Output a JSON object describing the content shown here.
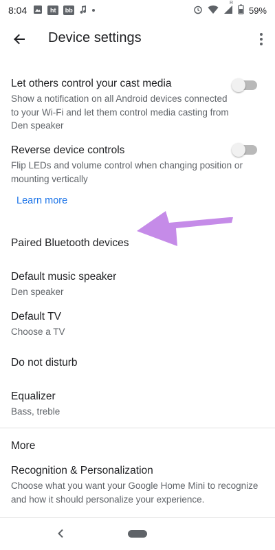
{
  "status_bar": {
    "time": "8:04",
    "battery": "59%",
    "notification_badges": [
      "ht",
      "bb"
    ],
    "signal_label": "R"
  },
  "app_bar": {
    "title": "Device settings"
  },
  "settings": {
    "cast_media": {
      "title": "Let others control your cast media",
      "subtitle": "Show a notification on all Android devices connected to your Wi-Fi and let them control media casting from Den speaker",
      "enabled": false
    },
    "reverse_controls": {
      "title": "Reverse device controls",
      "subtitle": "Flip LEDs and volume control when changing position or mounting vertically",
      "enabled": false
    },
    "learn_more": "Learn more",
    "paired_bluetooth": {
      "title": "Paired Bluetooth devices"
    },
    "default_music_speaker": {
      "title": "Default music speaker",
      "subtitle": "Den speaker"
    },
    "default_tv": {
      "title": "Default TV",
      "subtitle": "Choose a TV"
    },
    "do_not_disturb": {
      "title": "Do not disturb"
    },
    "equalizer": {
      "title": "Equalizer",
      "subtitle": "Bass, treble"
    }
  },
  "more_section": {
    "header": "More",
    "recognition": {
      "title": "Recognition & Personalization",
      "subtitle": "Choose what you want your Google Home Mini to recognize and how it should personalize your experience."
    }
  },
  "colors": {
    "link": "#1a73e8",
    "annotation_arrow": "#c58be8",
    "toggle_track_off": "#b9b9b9"
  },
  "icons": {
    "back": "arrow-left-icon",
    "overflow": "more-vert-icon",
    "nav_back": "chevron-left-icon",
    "nav_home": "home-pill-icon"
  }
}
